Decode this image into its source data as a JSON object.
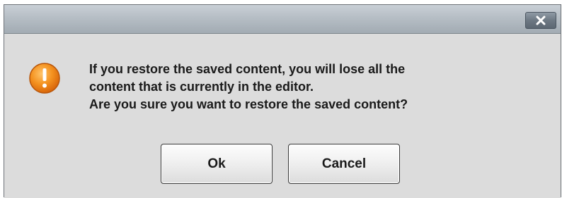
{
  "dialog": {
    "close_icon": "close-x-icon",
    "warning_icon": "warning-exclamation-icon",
    "message_lines": [
      "If you restore the saved content, you will lose all the",
      "content that is currently in the editor.",
      "Are you sure you want to restore the saved content?"
    ],
    "buttons": {
      "ok_label": "Ok",
      "cancel_label": "Cancel"
    },
    "colors": {
      "titlebar": "#b6bec5",
      "body": "#dcdcdc",
      "warning_orange": "#f08a1c"
    }
  }
}
